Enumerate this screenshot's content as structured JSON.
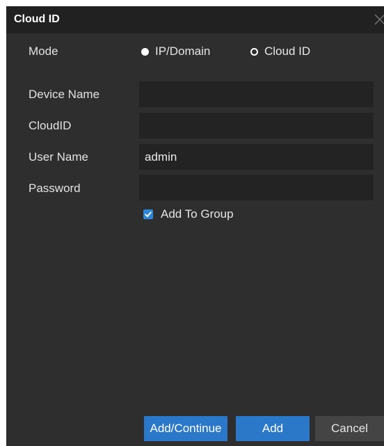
{
  "dialog": {
    "title": "Cloud ID"
  },
  "form": {
    "mode": {
      "label": "Mode",
      "options": [
        {
          "label": "IP/Domain",
          "selected": true
        },
        {
          "label": "Cloud ID",
          "selected": false
        }
      ]
    },
    "device_name": {
      "label": "Device Name",
      "value": ""
    },
    "cloud_id": {
      "label": "CloudID",
      "value": ""
    },
    "user_name": {
      "label": "User Name",
      "value": "admin"
    },
    "password": {
      "label": "Password",
      "value": ""
    },
    "add_to_group": {
      "label": "Add To Group",
      "checked": true
    }
  },
  "buttons": {
    "add_continue": "Add/Continue",
    "add": "Add",
    "cancel": "Cancel"
  },
  "colors": {
    "dialog_bg": "#2e2e2e",
    "titlebar_bg": "#212121",
    "input_bg": "#232323",
    "accent": "#2b78c9",
    "secondary_button": "#444444"
  }
}
